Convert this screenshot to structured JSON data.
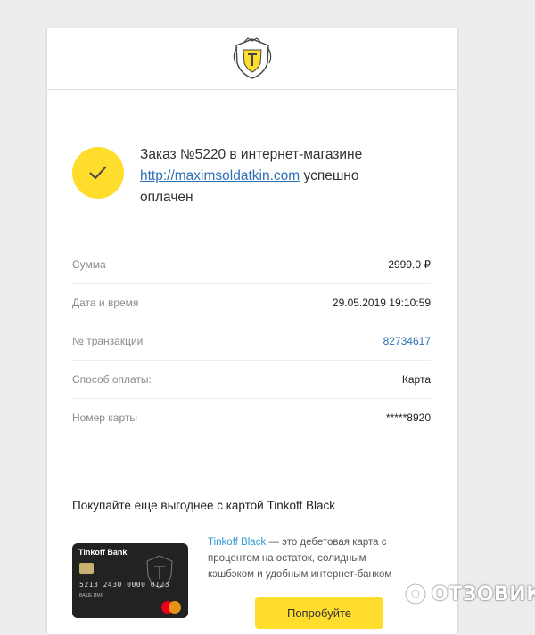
{
  "header": {
    "logo_icon": "tinkoff-crest-icon"
  },
  "status": {
    "icon": "checkmark-icon",
    "line1": "Заказ №5220 в интернет-магазине",
    "link": "http://maximsoldatkin.com",
    "line2_suffix": " успешно",
    "line3": "оплачен"
  },
  "details": [
    {
      "label": "Сумма",
      "value": "2999.0 ₽"
    },
    {
      "label": "Дата и время",
      "value": "29.05.2019 19:10:59"
    },
    {
      "label": "№ транзакции",
      "value": "82734617"
    },
    {
      "label": "Способ оплаты:",
      "value": "Карта"
    },
    {
      "label": "Номер карты",
      "value": "*****8920"
    }
  ],
  "promo": {
    "title": "Покупайте еще выгоднее с картой Tinkoff Black",
    "brand": "Tinkoff Black",
    "description": " — это дебетовая карта с процентом на остаток, солидным кэшбэком и удобным интернет-банком",
    "button_label": "Попробуйте",
    "card": {
      "bank_name": "Tinkoff Bank",
      "number": "5213 2430 0000 0123",
      "holder": "ВАШЕ ИМЯ",
      "brand_logo": "mastercard-logo"
    }
  },
  "watermark": {
    "text": "ОТЗОВИК",
    "icon": "otzovik-logo-icon"
  },
  "colors": {
    "accent_yellow": "#ffdd2d",
    "link_blue": "#2e6fb4",
    "brand_blue": "#2e9bd1"
  }
}
